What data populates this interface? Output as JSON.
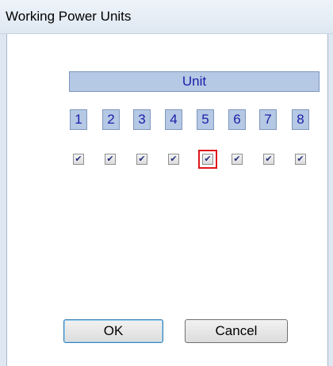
{
  "window": {
    "title": "Working Power Units"
  },
  "unit_header": "Unit",
  "units": [
    {
      "number": "1",
      "checked": true,
      "focused": false
    },
    {
      "number": "2",
      "checked": true,
      "focused": false
    },
    {
      "number": "3",
      "checked": true,
      "focused": false
    },
    {
      "number": "4",
      "checked": true,
      "focused": false
    },
    {
      "number": "5",
      "checked": true,
      "focused": true
    },
    {
      "number": "6",
      "checked": true,
      "focused": false
    },
    {
      "number": "7",
      "checked": true,
      "focused": false
    },
    {
      "number": "8",
      "checked": true,
      "focused": false
    }
  ],
  "buttons": {
    "ok": "OK",
    "cancel": "Cancel"
  },
  "colors": {
    "header_bg": "#b5c8e4",
    "header_text": "#1a1ea8",
    "focus_outline": "#e0161b"
  }
}
